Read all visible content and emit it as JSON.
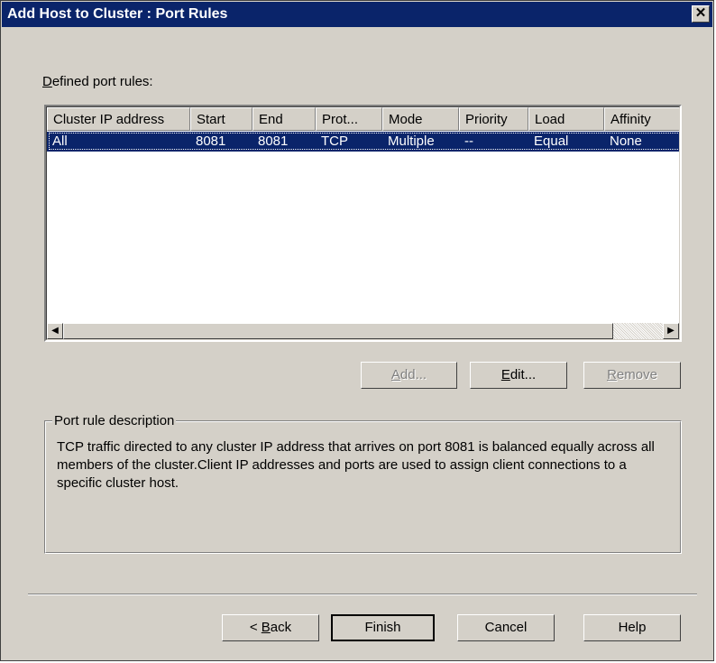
{
  "window": {
    "title": "Add Host to Cluster : Port Rules",
    "close_glyph": "✕"
  },
  "rules_label": {
    "first_letter": "D",
    "rest": "efined port rules:"
  },
  "table": {
    "columns": [
      "Cluster IP address",
      "Start",
      "End",
      "Prot...",
      "Mode",
      "Priority",
      "Load",
      "Affinity"
    ],
    "rows": [
      [
        "All",
        "8081",
        "8081",
        "TCP",
        "Multiple",
        "--",
        "Equal",
        "None"
      ]
    ]
  },
  "scrollbar": {
    "left_arrow": "◀",
    "right_arrow": "▶"
  },
  "buttons": {
    "add": {
      "hotkey": "A",
      "rest": "dd..."
    },
    "edit": {
      "hotkey": "E",
      "rest": "dit..."
    },
    "remove": {
      "hotkey": "R",
      "rest": "emove"
    },
    "back": {
      "prefix": "< ",
      "hotkey": "B",
      "rest": "ack"
    },
    "finish": "Finish",
    "cancel": "Cancel",
    "help": "Help"
  },
  "description": {
    "legend": "Port rule description",
    "text": "TCP traffic directed to any cluster IP address that arrives on port 8081 is balanced equally across all members of the cluster.Client IP addresses and ports are used to assign client connections to a specific cluster host."
  }
}
